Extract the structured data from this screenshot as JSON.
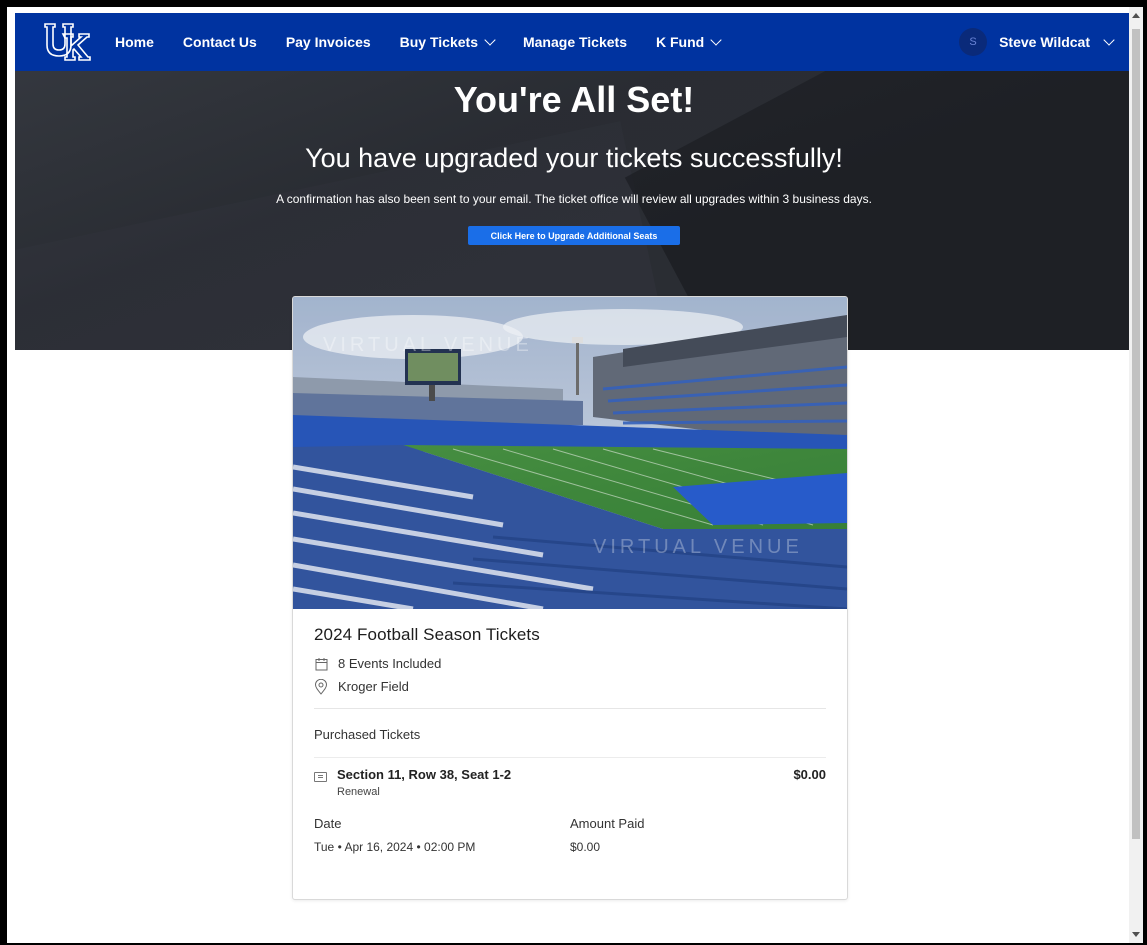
{
  "nav": {
    "logo_icon": "uk-logo-icon",
    "links": [
      {
        "label": "Home"
      },
      {
        "label": "Contact Us"
      },
      {
        "label": "Pay Invoices"
      },
      {
        "label": "Buy Tickets"
      },
      {
        "label": "Manage Tickets"
      },
      {
        "label": "K Fund"
      }
    ],
    "user": {
      "avatar_initial": "S",
      "name": "Steve Wildcat"
    },
    "bar_color": "#0033a0"
  },
  "hero": {
    "title": "You're All Set!",
    "subtitle": "You have upgraded your tickets successfully!",
    "note": "A confirmation has also been sent to your email. The ticket office will review all upgrades within 3 business days.",
    "button_label": "Click Here to Upgrade Additional Seats",
    "button_color": "#1a6ee8"
  },
  "card": {
    "image_watermark": "VIRTUAL VENUE",
    "title": "2024 Football Season Tickets",
    "events": "8 Events Included",
    "venue": "Kroger Field",
    "purchased_label": "Purchased Tickets",
    "ticket": {
      "seat": "Section 11, Row 38, Seat 1-2",
      "type": "Renewal",
      "price": "$0.00"
    },
    "date_label": "Date",
    "date_value": "Tue • Apr 16, 2024 • 02:00 PM",
    "amount_label": "Amount Paid",
    "amount_value": "$0.00"
  }
}
